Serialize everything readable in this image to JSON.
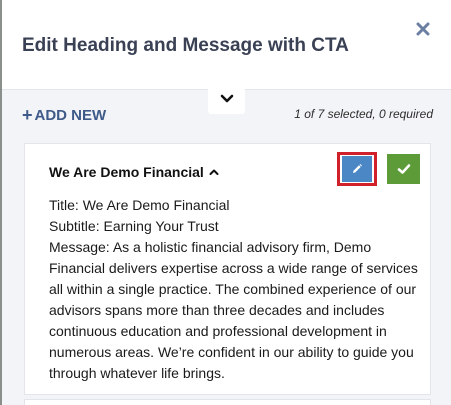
{
  "dialog": {
    "title": "Edit Heading and Message with CTA"
  },
  "toolbar": {
    "add_new_label": "ADD NEW",
    "add_new_prefix": "+",
    "selection_status": "1 of 7 selected, 0 required"
  },
  "item": {
    "heading": "We Are Demo Financial",
    "title_line": "Title: We Are Demo Financial",
    "subtitle_line": "Subtitle: Earning Your Trust",
    "message_line": "Message: As a holistic financial advisory firm, Demo Financial delivers expertise across a wide range of services all within a single practice. The combined experience of our advisors spans more than three decades and includes continuous education and professional development in numerous areas. We’re confident in our ability to guide you through whatever life brings."
  },
  "colors": {
    "title": "#3a4154",
    "accent": "#3e5a89",
    "edit_button": "#4b86c5",
    "highlight_border": "#d0202a",
    "confirm_button": "#5d9b38",
    "background": "#f3f4f7"
  },
  "icons": {
    "close": "close-icon",
    "collapse": "chevron-down-icon",
    "heading_toggle": "chevron-up-icon",
    "edit": "pencil-icon",
    "confirm": "check-icon"
  }
}
